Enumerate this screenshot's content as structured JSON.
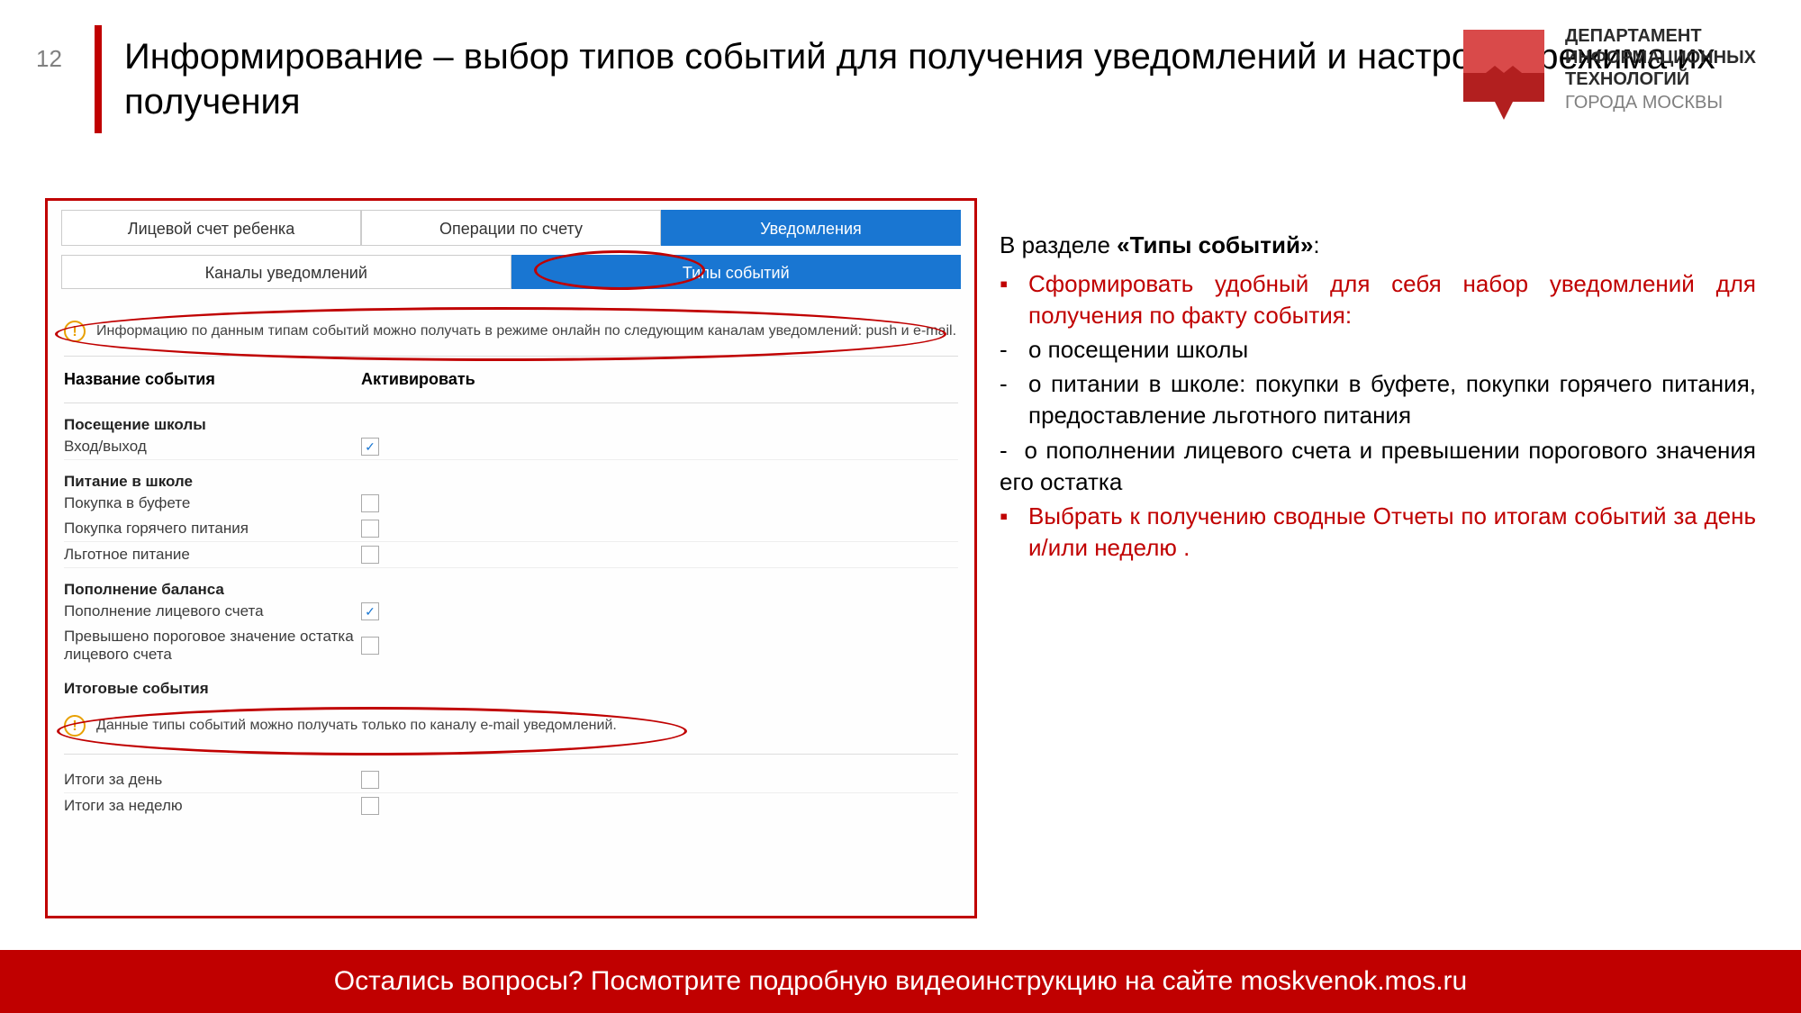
{
  "slide_number": "12",
  "title": "Информирование – выбор типов событий для получения уведомлений и настройка режима их получения",
  "logo": {
    "l1": "ДЕПАРТАМЕНТ",
    "l2": "ИНФОРМАЦИОННЫХ",
    "l3": "ТЕХНОЛОГИЙ",
    "l4": "ГОРОДА МОСКВЫ"
  },
  "screenshot": {
    "tabs1": [
      "Лицевой счет ребенка",
      "Операции по счету",
      "Уведомления"
    ],
    "tabs1_active": 2,
    "tabs2": [
      "Каналы уведомлений",
      "Типы событий"
    ],
    "tabs2_active": 1,
    "alert1": "Информацию по данным типам событий можно получать в режиме онлайн по следующим каналам уведомлений: push и e-mail.",
    "col1": "Название события",
    "col2": "Активировать",
    "groups": [
      {
        "title": "Посещение школы",
        "items": [
          {
            "name": "Вход/выход",
            "checked": true
          }
        ]
      },
      {
        "title": "Питание в школе",
        "items": [
          {
            "name": "Покупка в буфете",
            "checked": false
          },
          {
            "name": "Покупка горячего питания",
            "checked": false
          },
          {
            "name": "Льготное питание",
            "checked": false
          }
        ]
      },
      {
        "title": "Пополнение баланса",
        "items": [
          {
            "name": "Пополнение лицевого счета",
            "checked": true
          },
          {
            "name": "Превышено пороговое значение остатка лицевого счета",
            "checked": false
          }
        ]
      },
      {
        "title": "Итоговые события",
        "items": []
      }
    ],
    "alert2": "Данные типы событий можно получать только по каналу e-mail уведомлений.",
    "final_items": [
      {
        "name": "Итоги за день",
        "checked": false
      },
      {
        "name": "Итоги за неделю",
        "checked": false
      }
    ]
  },
  "sidebar": {
    "intro_pre": "В разделе ",
    "intro_bold": "«Типы событий»",
    "intro_post": ":",
    "b1": "Сформировать удобный для себя набор уведомлений для получения по факту события:",
    "d1": "о посещении школы",
    "d2": "о питании в школе: покупки в буфете, покупки горячего питания, предоставление льготного питания",
    "d3": "о пополнении лицевого счета и превышении порогового значения его остатка",
    "b2": "Выбрать к получению сводные Отчеты по итогам событий за день и/или неделю ."
  },
  "footer": "Остались вопросы? Посмотрите подробную видеоинструкцию на сайте moskvenok.mos.ru"
}
